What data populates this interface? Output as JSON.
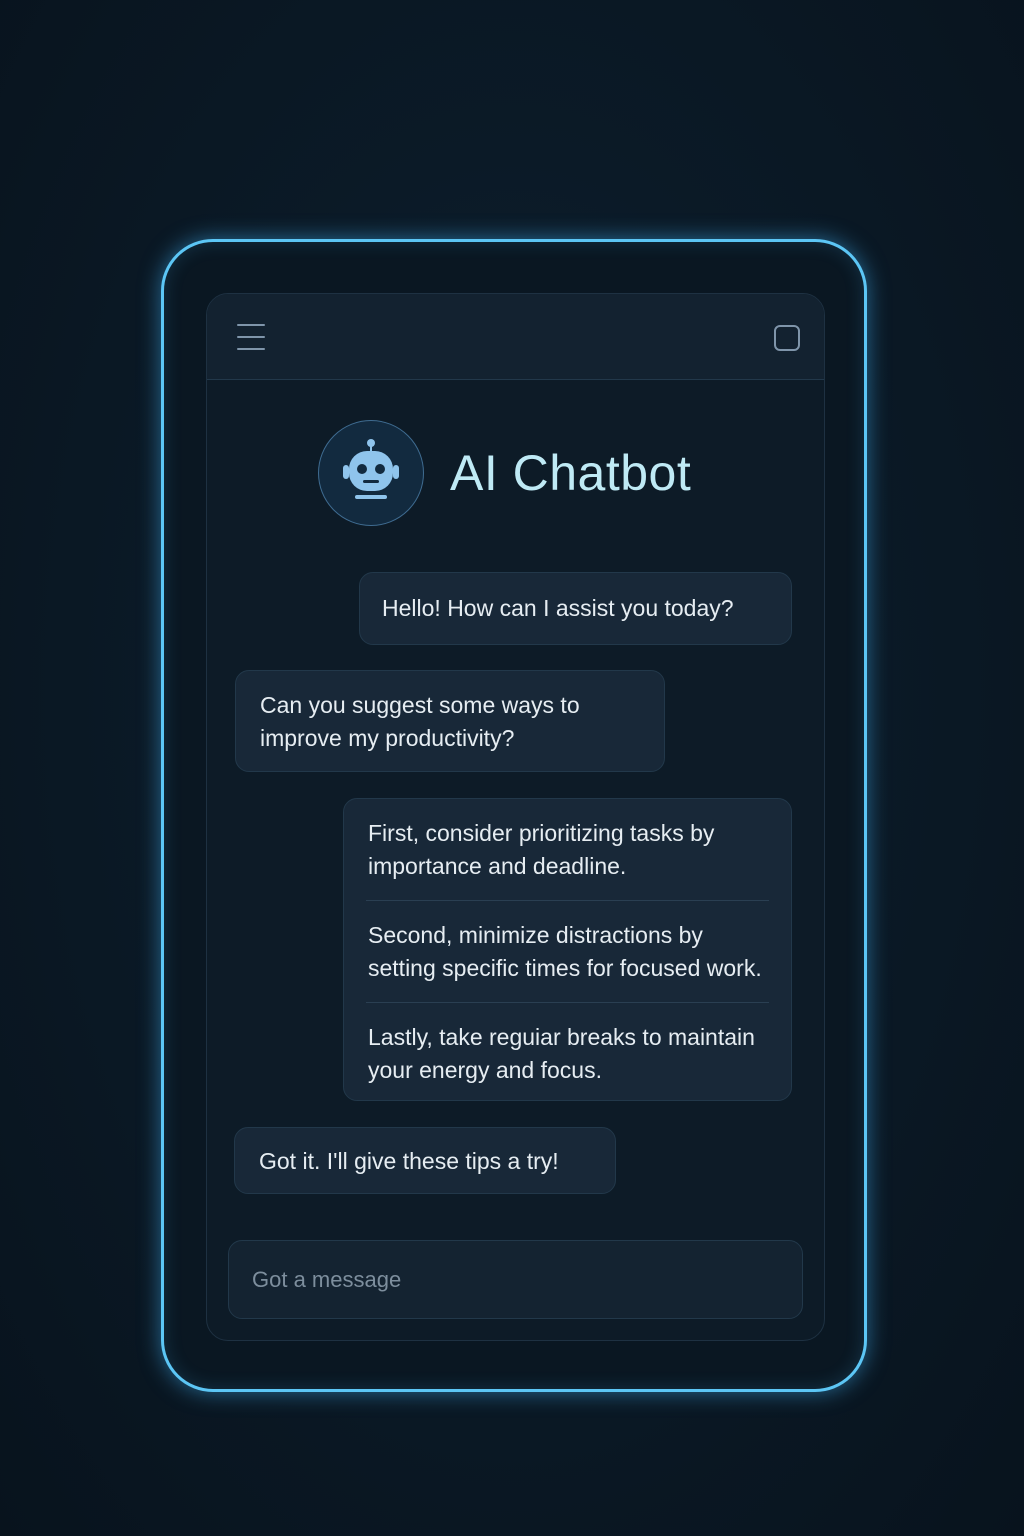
{
  "header": {
    "title": "AI Chatbot",
    "avatar_icon": "robot-icon"
  },
  "toolbar": {
    "menu_icon": "hamburger-menu-icon",
    "window_icon": "square-icon"
  },
  "messages": [
    {
      "role": "bot",
      "text": "Hello! How can I assist you today?"
    },
    {
      "role": "user",
      "text": "Can you suggest some ways to improve my productivity?"
    },
    {
      "role": "bot",
      "tips": [
        "First, consider prioritizing tasks by importance and deadline.",
        "Second, minimize distractions by setting specific times for focused work.",
        "Lastly, take reguiar breaks to maintain your energy and focus."
      ]
    },
    {
      "role": "user",
      "text": "Got it. I'll give these tips a try!"
    }
  ],
  "composer": {
    "placeholder": "Got a message",
    "value": ""
  },
  "colors": {
    "accent_glow": "#5cc6f5",
    "title": "#bfeaf5",
    "bubble": "#182838",
    "background": "#0b1a27"
  }
}
